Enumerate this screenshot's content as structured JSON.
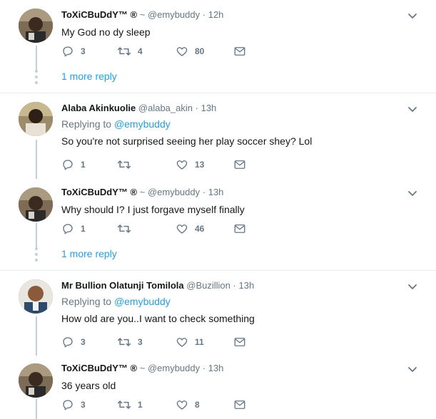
{
  "tweets": [
    {
      "display_name": "ToXiCBuDdY™ ®",
      "handle": "~ @emybuddy",
      "time": "12h",
      "reply_to_label": "",
      "reply_to_handle": "",
      "text": "My God no dy sleep",
      "replies": "3",
      "retweets": "4",
      "likes": "80"
    },
    {
      "display_name": "Alaba Akinkuolie",
      "handle": "@alaba_akin",
      "time": "13h",
      "reply_to_label": "Replying to",
      "reply_to_handle": "@emybuddy",
      "text": "So you're not surprised seeing her play soccer shey? Lol",
      "replies": "1",
      "retweets": "",
      "likes": "13"
    },
    {
      "display_name": "ToXiCBuDdY™ ®",
      "handle": "~ @emybuddy",
      "time": "13h",
      "reply_to_label": "",
      "reply_to_handle": "",
      "text": "Why should I? I just forgave myself finally",
      "replies": "1",
      "retweets": "",
      "likes": "46"
    },
    {
      "display_name": "Mr Bullion Olatunji Tomilola",
      "handle": "@Buzillion",
      "time": "13h",
      "reply_to_label": "Replying to",
      "reply_to_handle": "@emybuddy",
      "text": "How old are you..I want to check something",
      "replies": "3",
      "retweets": "3",
      "likes": "11"
    },
    {
      "display_name": "ToXiCBuDdY™ ®",
      "handle": "~ @emybuddy",
      "time": "13h",
      "reply_to_label": "",
      "reply_to_handle": "",
      "text": "36 years old",
      "replies": "3",
      "retweets": "1",
      "likes": "8"
    }
  ],
  "dot_separator": "·",
  "more_reply_label": "1 more reply",
  "colors": {
    "link": "#1da1f2",
    "secondary_text": "#657786",
    "thread_line": "#c4cfd6",
    "divider": "#e6ecf0"
  },
  "icons": {
    "reply": "reply-icon",
    "retweet": "retweet-icon",
    "like": "heart-icon",
    "dm": "envelope-icon",
    "caret": "chevron-down-icon"
  }
}
